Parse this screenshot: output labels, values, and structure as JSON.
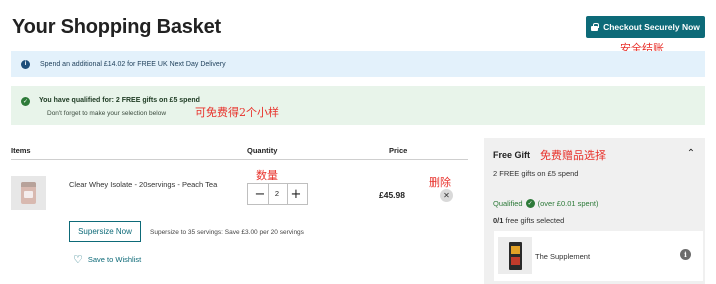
{
  "page": {
    "title": "Your Shopping Basket",
    "checkout_label": "Checkout Securely Now"
  },
  "banners": {
    "delivery_text": "Spend an additional £14.02 for FREE UK Next Day Delivery",
    "gift_title": "You have qualified for: 2 FREE gifts on £5 spend",
    "gift_sub": "Don't forget to make your selection below"
  },
  "table": {
    "headers": {
      "items": "Items",
      "quantity": "Quantity",
      "price": "Price"
    }
  },
  "item": {
    "name": "Clear Whey Isolate - 20servings - Peach Tea",
    "quantity": "2",
    "minus": "−",
    "plus": "+",
    "price": "£45.98",
    "remove": "✕",
    "supersize_label": "Supersize Now",
    "supersize_note": "Supersize to 35 servings: Save £3.00 per 20 servings",
    "wishlist_label": "Save to Wishlist"
  },
  "gift_panel": {
    "title": "Free Gift",
    "subtitle": "2 FREE gifts on £5 spend",
    "qualified": "Qualified",
    "qualified_note": "(over £0.01 spent)",
    "count": "0/1",
    "count_label": "free gifts selected",
    "gift_name": "The Supplement"
  },
  "annotations": {
    "checkout": "安全结账",
    "gift_banner": "可免费得2个小样",
    "quantity": "数量",
    "remove": "删除",
    "gift_panel": "免费赠品选择"
  },
  "colors": {
    "accent": "#0d6a78",
    "success": "#2d7a39",
    "info_bg": "#e3f1fb",
    "success_bg": "#e8f4ea",
    "annotation": "#e8302a"
  },
  "icons": {
    "checkout": "lock-icon",
    "delivery": "info-icon",
    "gift_banner": "check-circle-icon",
    "remove": "close-icon",
    "wishlist": "heart-icon",
    "panel_toggle": "chevron-up-icon",
    "qualified": "check-circle-icon",
    "gift_info": "info-icon"
  }
}
